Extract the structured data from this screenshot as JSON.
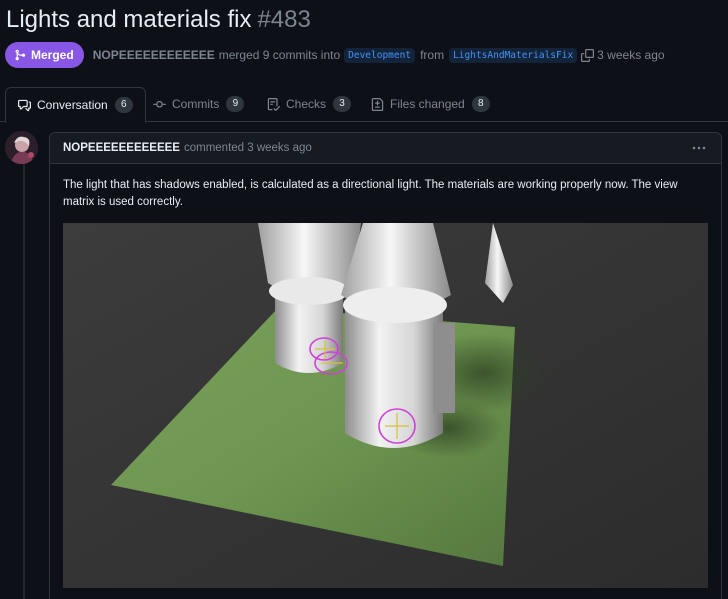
{
  "pr": {
    "title": "Lights and materials fix",
    "number": "#483",
    "state_label": "Merged",
    "author": "NOPEEEEEEEEEEEE",
    "merged_text": "merged 9 commits into",
    "base_branch": "Development",
    "from_text": "from",
    "head_branch": "LightsAndMaterialsFix",
    "time_ago": "3 weeks ago"
  },
  "tabs": [
    {
      "label": "Conversation",
      "count": "6",
      "icon": "comment-discussion-icon",
      "active": true
    },
    {
      "label": "Commits",
      "count": "9",
      "icon": "git-commit-icon"
    },
    {
      "label": "Checks",
      "count": "3",
      "icon": "checklist-icon"
    },
    {
      "label": "Files changed",
      "count": "8",
      "icon": "file-diff-icon"
    }
  ],
  "comment": {
    "author": "NOPEEEEEEEEEEEE",
    "meta": "commented 3 weeks ago",
    "body": "The light that has shadows enabled, is calculated as a directional light. The materials are working properly now. The view matrix is used correctly."
  },
  "colors": {
    "merged": "#8957e5",
    "link": "#4493f8",
    "background": "#0d1117"
  }
}
